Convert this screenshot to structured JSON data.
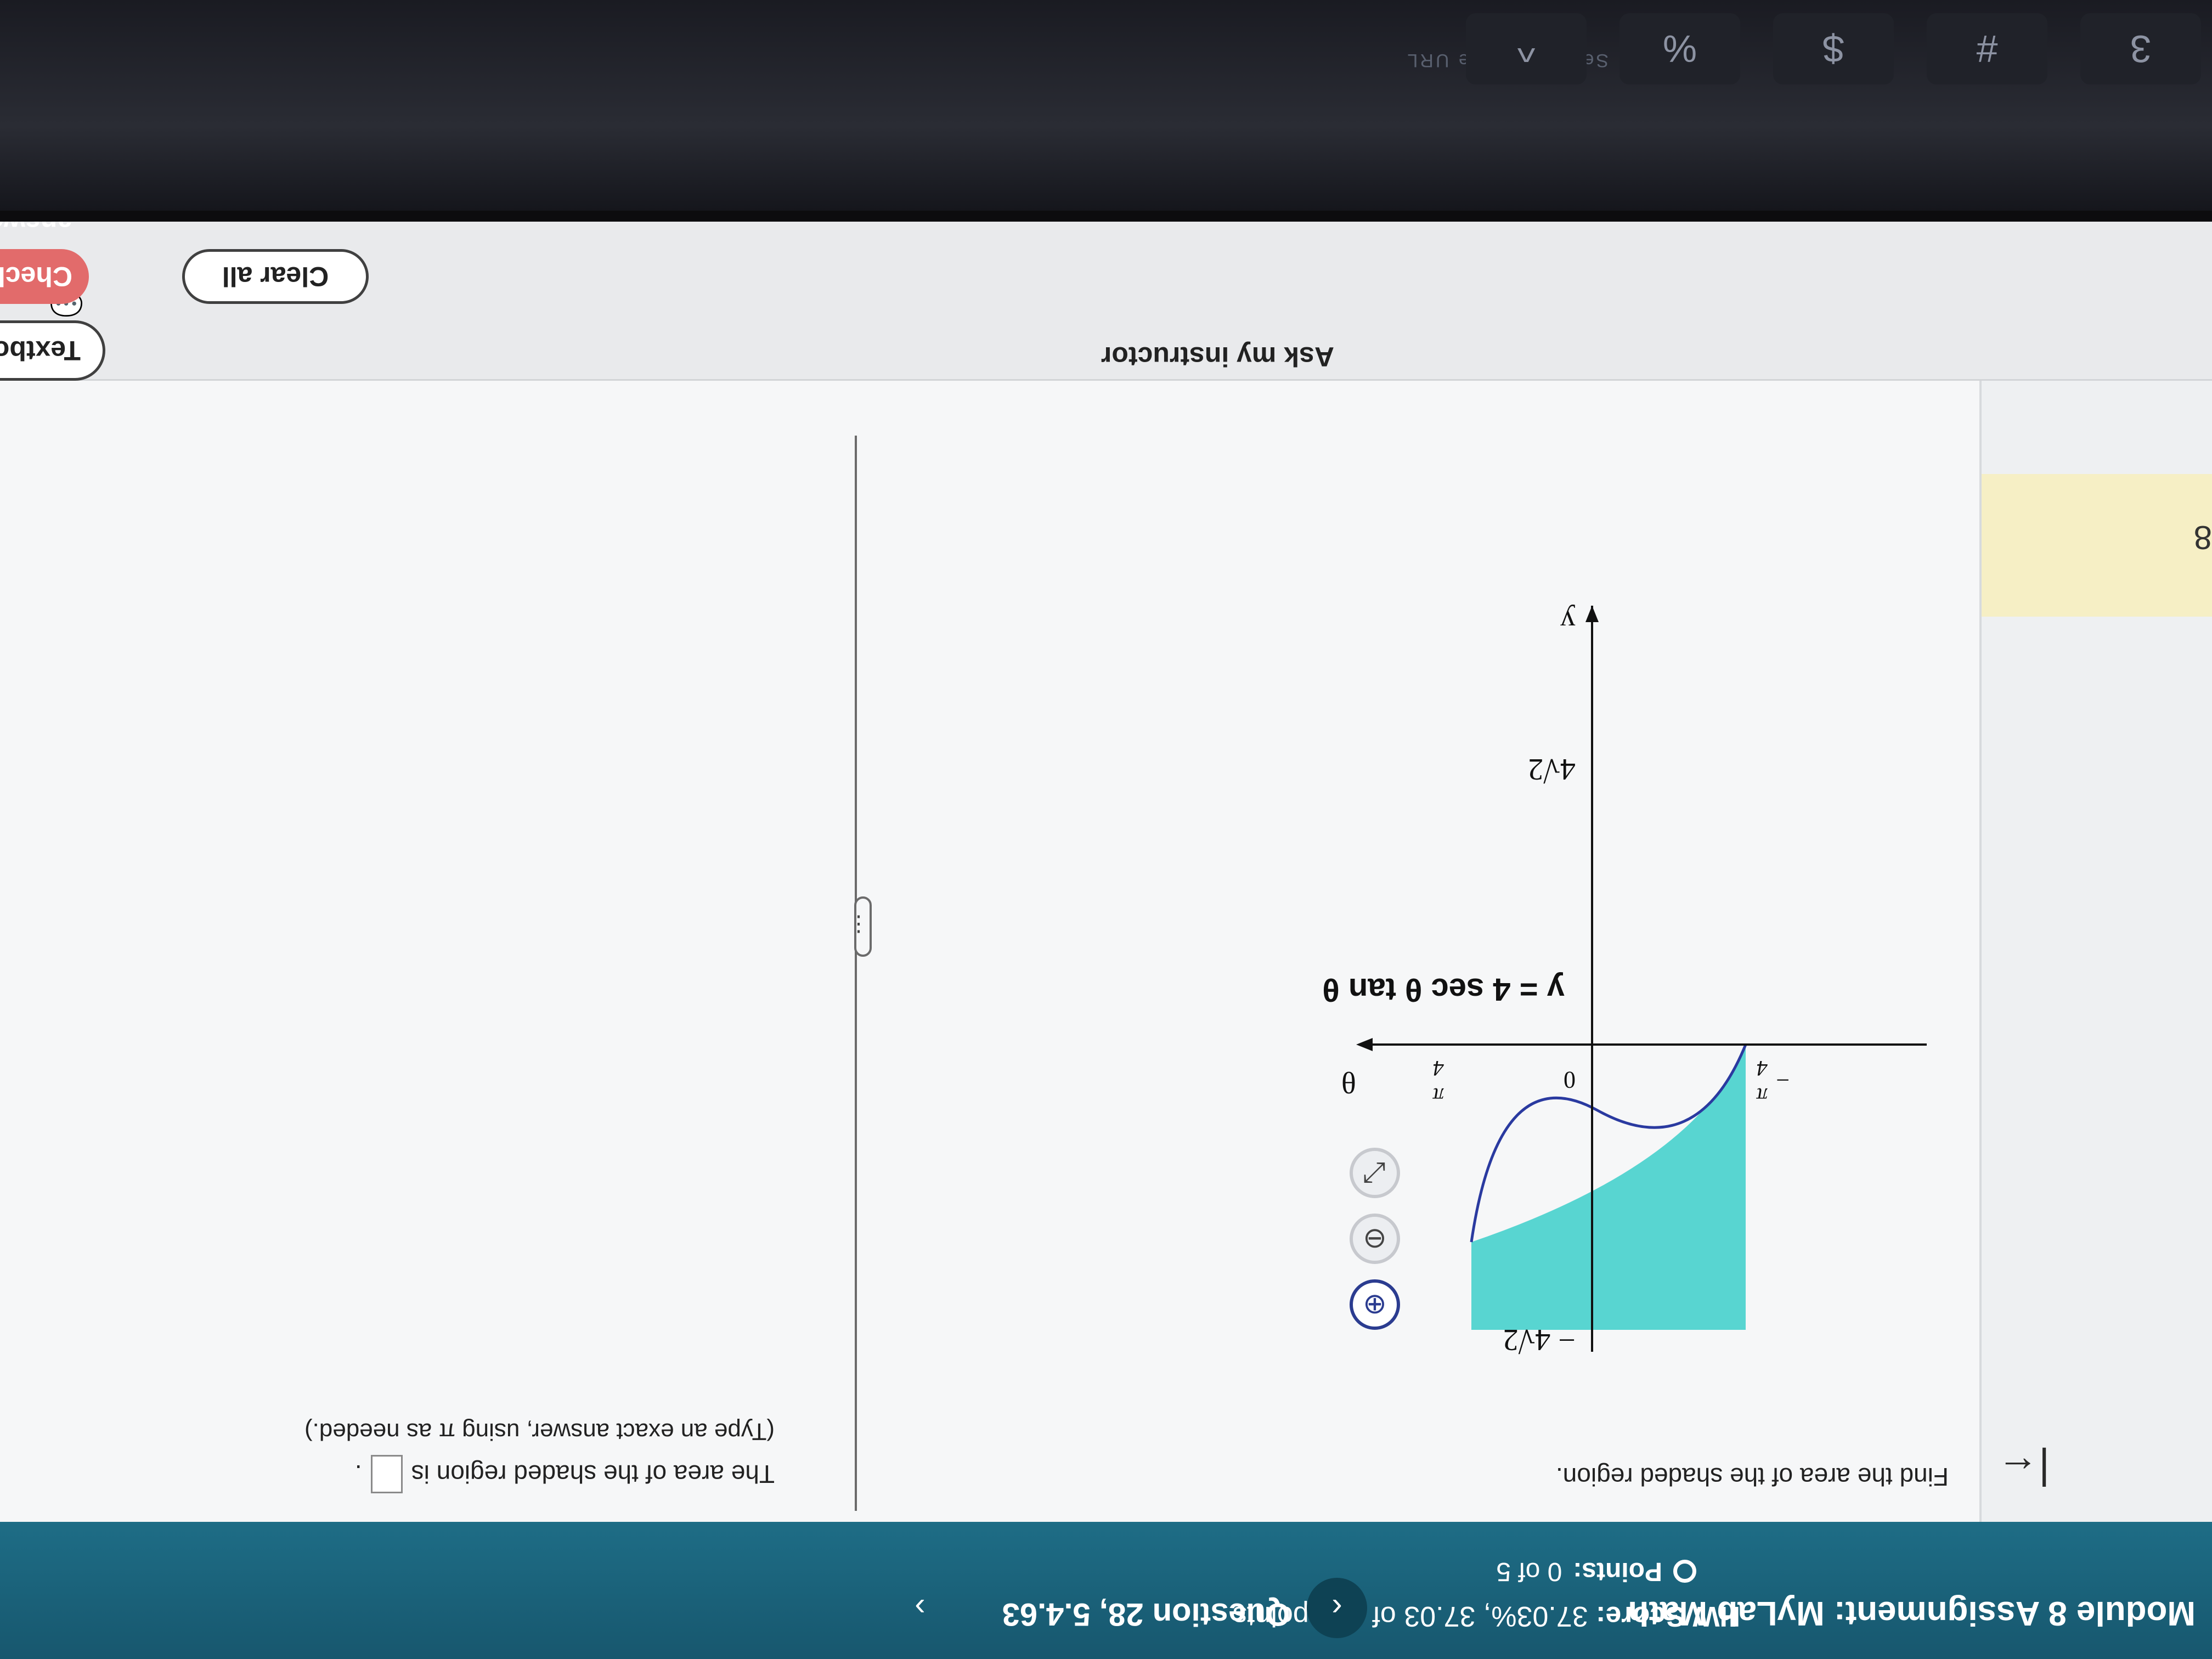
{
  "header": {
    "app_title": "Module 8 Assignment: MyLab Math",
    "hw_score_label": "HW Score:",
    "hw_score_value": "37.03%, 37.03 of 100 points",
    "points_label": "Points:",
    "points_value": "0 of 5",
    "nav_prev": "‹",
    "nav_next": "›",
    "question_label": "Question 28, 5.4.63"
  },
  "question": {
    "prompt": "Find the area of the shaded region.",
    "answer_prefix": "The area of the shaded region is",
    "answer_suffix": ".",
    "hint": "(Type an exact answer, using π as needed.)"
  },
  "graph": {
    "y_axis_label": "y",
    "x_axis_label": "θ",
    "y_top_label": "4√2",
    "y_bottom_label": "− 4√2",
    "x_origin_label": "0",
    "x_pos_label_num": "π",
    "x_pos_label_den": "4",
    "x_neg_sign": "−",
    "x_neg_label_num": "π",
    "x_neg_label_den": "4",
    "curve_label": "y = 4 sec θ tan θ",
    "fill_color": "#4fd3cf",
    "curve_color": "#2a3aa0"
  },
  "tools": {
    "zoom_in_icon": "⊕",
    "zoom_out_icon": "⊖",
    "popout_icon": "⤢"
  },
  "footer": {
    "textbook_label": "Textbook",
    "ask_instructor_label": "Ask my instructor",
    "clear_all_label": "Clear all",
    "check_label": "Check answer"
  },
  "sidebar": {
    "collapse_icon": "|←",
    "item_number": "8"
  },
  "device": {
    "url_hint": "Search or type URL",
    "keys": [
      "3",
      "#",
      "$",
      "%",
      "^"
    ]
  }
}
